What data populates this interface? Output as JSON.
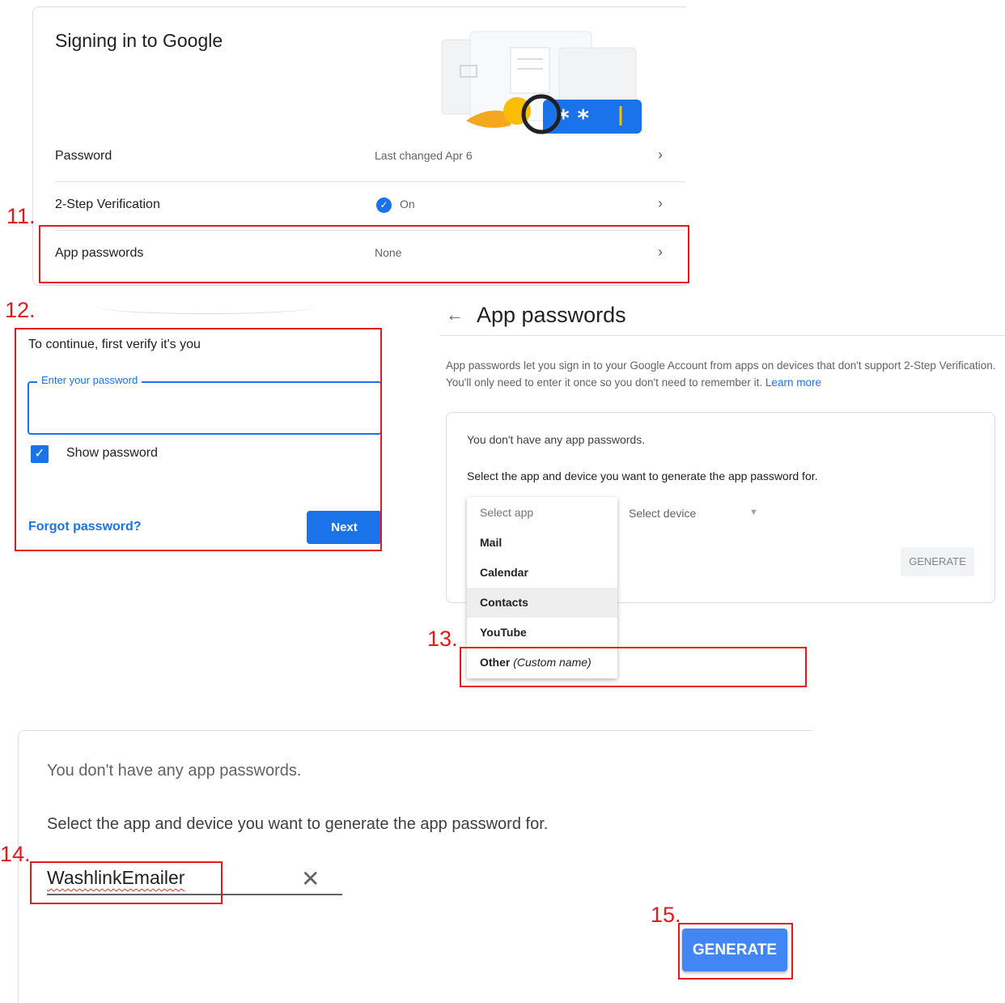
{
  "signin_panel": {
    "title": "Signing in to Google",
    "rows": [
      {
        "label": "Password",
        "value": "Last changed Apr 6"
      },
      {
        "label": "2-Step Verification",
        "value": "On"
      },
      {
        "label": "App passwords",
        "value": "None"
      }
    ],
    "chevron": "›"
  },
  "verify_panel": {
    "title": "To continue, first verify it's you",
    "password_label": "Enter your password",
    "show_password_label": "Show password",
    "show_password_checked": true,
    "forgot_link": "Forgot password?",
    "next_button": "Next"
  },
  "app_passwords_panel": {
    "back_icon": "←",
    "title": "App passwords",
    "description": "App passwords let you sign in to your Google Account from apps on devices that don't support 2-Step Verification. You'll only need to enter it once so you don't need to remember it.",
    "learn_more": "Learn more",
    "no_passwords": "You don't have any app passwords.",
    "select_prompt": "Select the app and device you want to generate the app password for.",
    "app_menu": {
      "placeholder": "Select app",
      "options": [
        "Mail",
        "Calendar",
        "Contacts",
        "YouTube"
      ],
      "other_label": "Other",
      "other_hint": "(Custom name)",
      "highlighted": "Contacts"
    },
    "device_select": "Select device",
    "generate_button": "GENERATE"
  },
  "custom_name_panel": {
    "no_passwords": "You don't have any app passwords.",
    "select_prompt": "Select the app and device you want to generate the app password for.",
    "custom_name_value": "WashlinkEmailer",
    "clear_icon": "✕",
    "generate_button": "GENERATE"
  },
  "step_labels": [
    "11.",
    "12.",
    "13.",
    "14.",
    "15."
  ],
  "colors": {
    "accent_blue": "#1a73e8",
    "generate_blue": "#4285f4",
    "highlight_red": "#e4191c",
    "verified_blue": "#1a73e8"
  }
}
